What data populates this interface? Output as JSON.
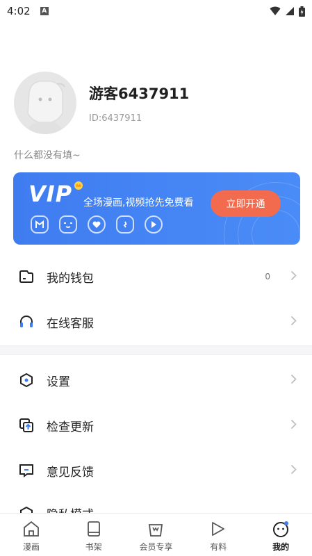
{
  "status_bar": {
    "time": "4:02",
    "notification_glyph": "A"
  },
  "profile": {
    "username": "游客6437911",
    "user_id": "ID:6437911",
    "bio": "什么都没有填~"
  },
  "vip": {
    "logo": "VIP",
    "tagline": "全场漫画,视频抢先免费看",
    "button_label": "立即开通",
    "icons": [
      "manga-icon",
      "anime-icon",
      "heart-icon",
      "crown-badge-icon",
      "play-icon"
    ],
    "button_color": "#f26b4f",
    "card_color": "#4285f4"
  },
  "menu": {
    "wallet": {
      "label": "我的钱包",
      "value": "0"
    },
    "support": {
      "label": "在线客服"
    },
    "settings": {
      "label": "设置"
    },
    "update": {
      "label": "检查更新"
    },
    "feedback": {
      "label": "意见反馈"
    },
    "partial": {
      "label": "隐私模式"
    }
  },
  "tabs": [
    {
      "label": "漫画",
      "icon": "home-icon"
    },
    {
      "label": "书架",
      "icon": "bookshelf-icon"
    },
    {
      "label": "会员专享",
      "icon": "vip-bag-icon"
    },
    {
      "label": "有料",
      "icon": "video-play-icon"
    },
    {
      "label": "我的",
      "icon": "profile-face-icon",
      "active": true
    }
  ]
}
